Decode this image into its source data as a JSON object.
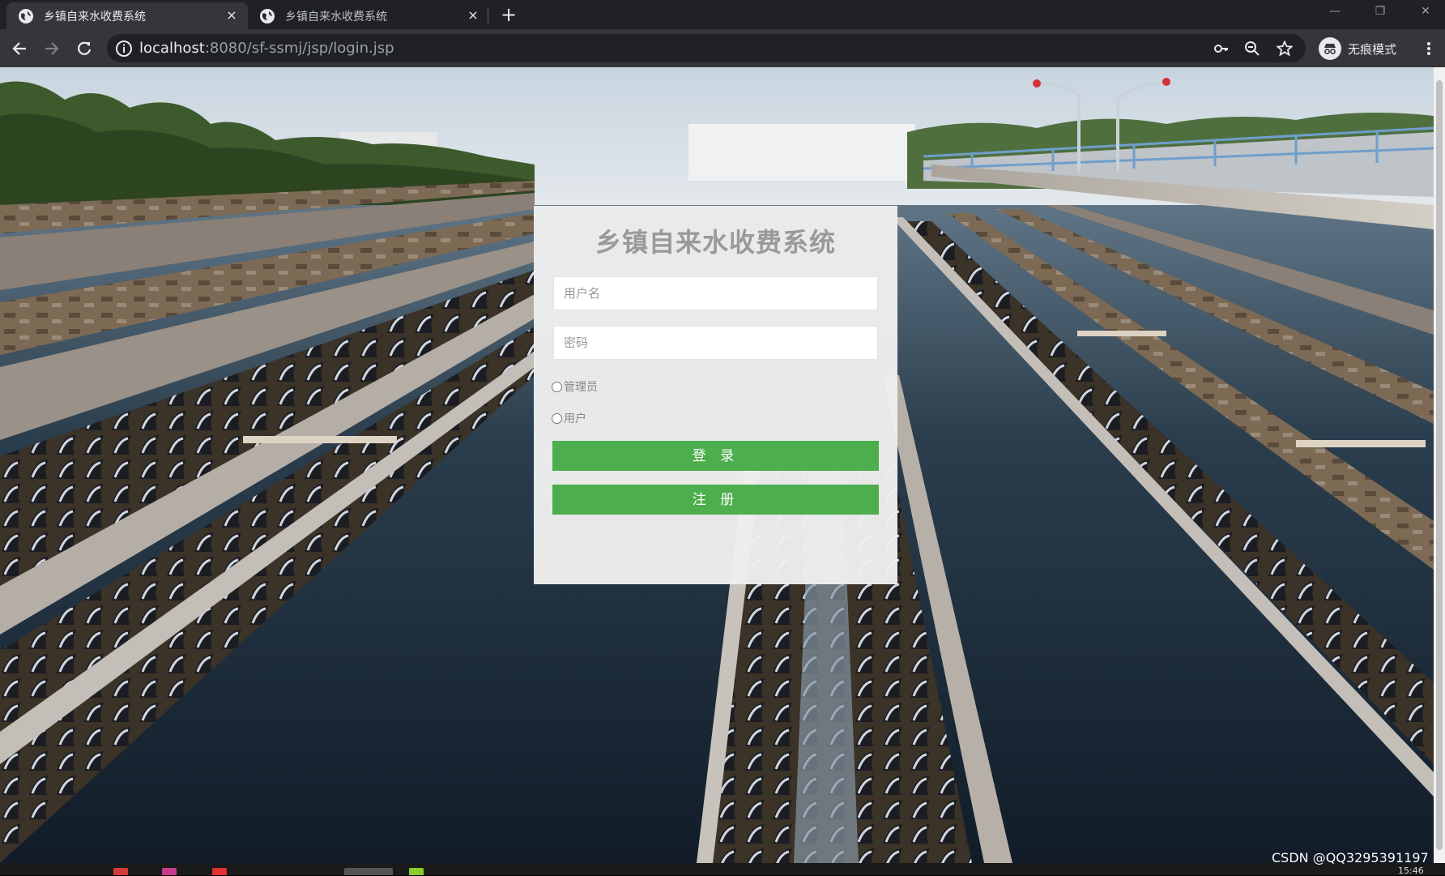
{
  "browser": {
    "tabs": [
      {
        "title": "乡镇自来水收费系统",
        "active": true
      },
      {
        "title": "乡镇自来水收费系统",
        "active": false
      }
    ],
    "close_symbol": "×",
    "new_tab_symbol": "+",
    "url_host": "localhost",
    "url_rest": ":8080/sf-ssmj/jsp/login.jsp",
    "profile_label": "无痕模式",
    "icons": [
      "back-icon",
      "forward-icon",
      "reload-icon",
      "info-icon",
      "key-icon",
      "zoom-icon",
      "star-icon",
      "incognito-icon",
      "menu-icon"
    ]
  },
  "login": {
    "title": "乡镇自来水收费系统",
    "username_placeholder": "用户名",
    "password_placeholder": "密码",
    "role_options": [
      "管理员",
      "用户"
    ],
    "login_button": "登 录",
    "register_button": "注 册"
  },
  "colors": {
    "button_green": "#4cae4c",
    "panel_bg": "#eeeeee",
    "title_gray": "#999999"
  },
  "watermark": "CSDN @QQ3295391197",
  "clock": "15:46"
}
